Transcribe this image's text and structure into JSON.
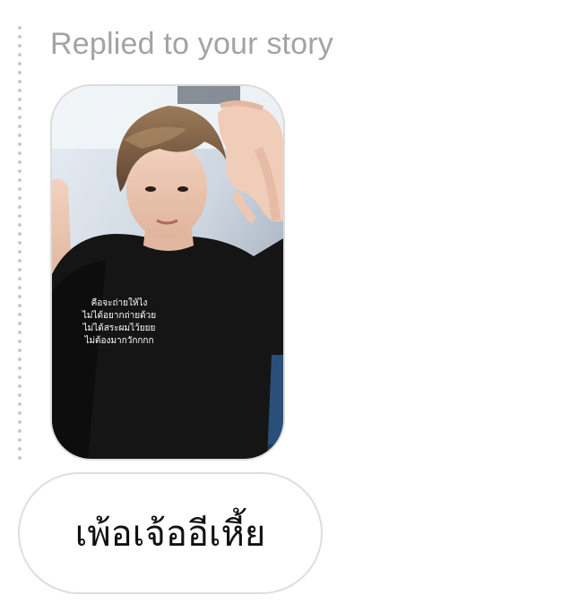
{
  "reply_label": "Replied to your story",
  "story": {
    "caption_lines": [
      "คือจะถ่ายให้ไง",
      "ไม่ได้อยากถ่ายด้วย",
      "ไม่ได้สระผมไว้ยยย",
      "ไม่ต้องมากวักกกก"
    ]
  },
  "message": {
    "text": "เพ้อเจ้ออีเหี้ย"
  },
  "colors": {
    "label_gray": "#a3a3a3",
    "bubble_border": "#dedede",
    "text_dark": "#111111"
  }
}
